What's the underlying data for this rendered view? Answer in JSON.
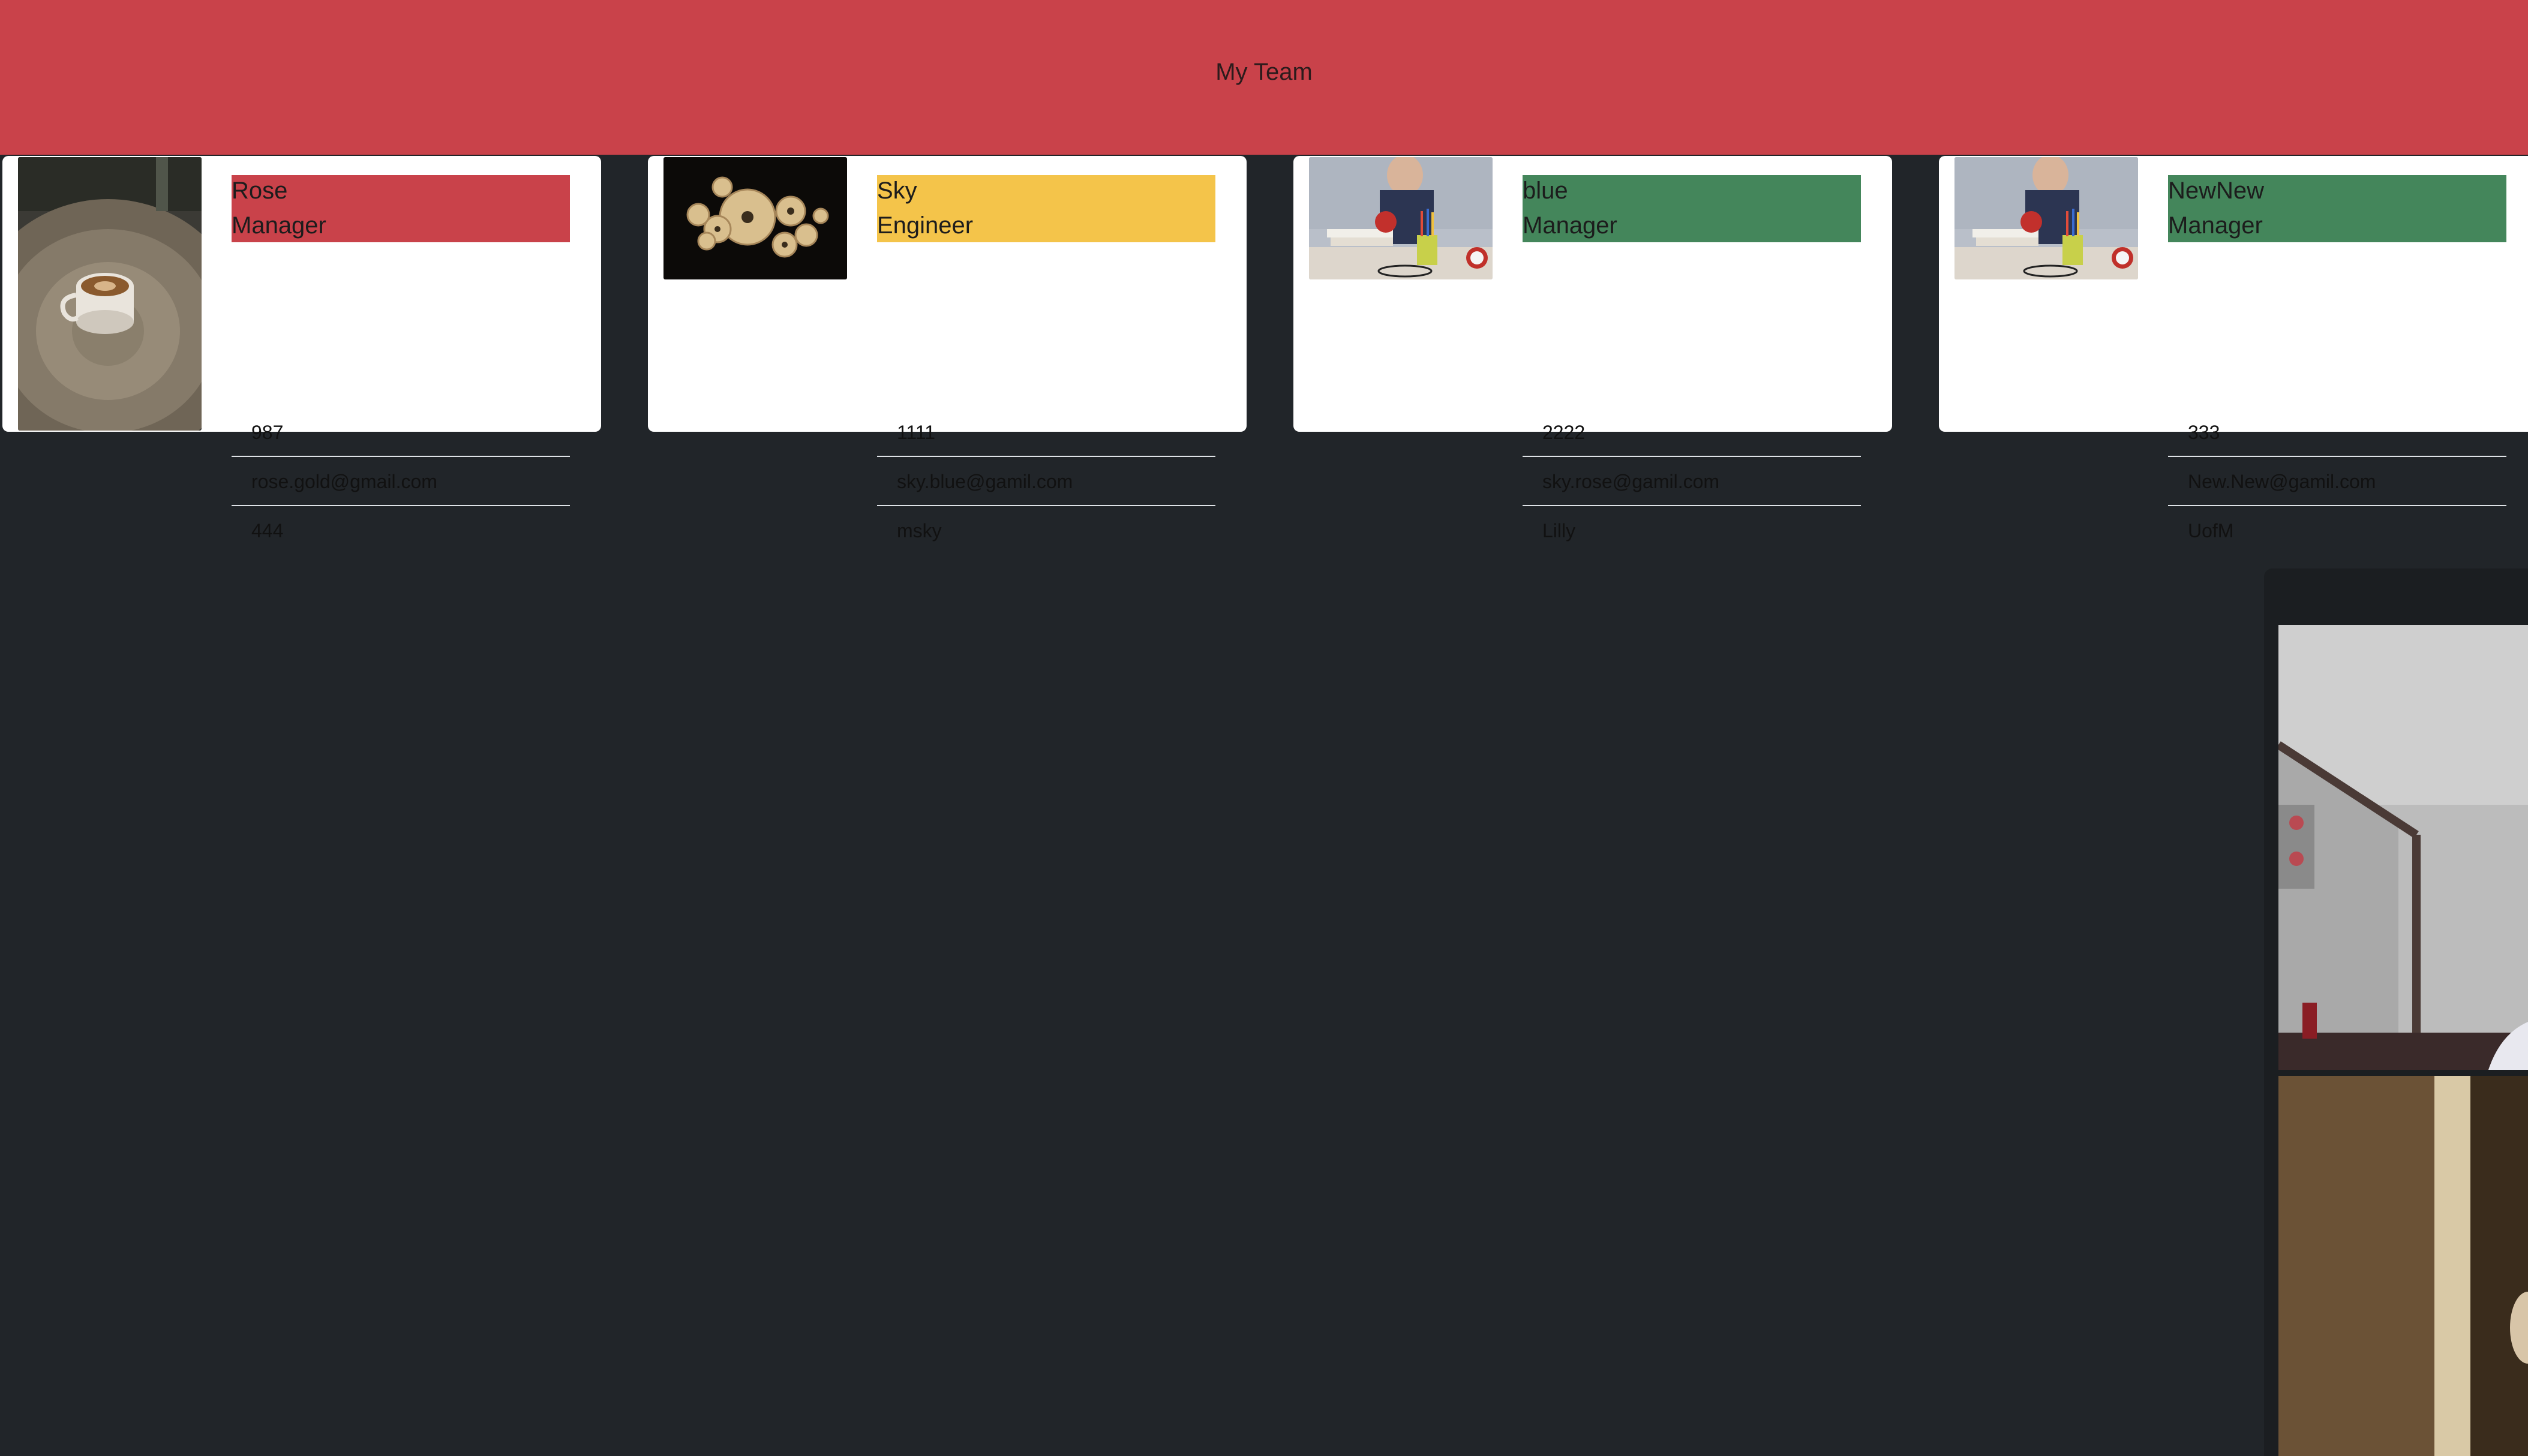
{
  "header": {
    "title": "My Team"
  },
  "colors": {
    "header_bg": "#c9424a",
    "page_bg": "#212529",
    "manager": "#c9424a",
    "engineer": "#f4c44a",
    "intern": "#44865b"
  },
  "members": [
    {
      "name": "Rose",
      "role": "Manager",
      "id": "987",
      "email": "rose.gold@gmail.com",
      "extra": "444",
      "role_color": "#c9424a",
      "photo_icon": "coffee-cup-photo"
    },
    {
      "name": "Sky",
      "role": "Engineer",
      "id": "1111",
      "email": "sky.blue@gamil.com",
      "extra": "msky",
      "role_color": "#f4c44a",
      "photo_icon": "gears-photo"
    },
    {
      "name": "blue",
      "role": "Manager",
      "id": "2222",
      "email": "sky.rose@gamil.com",
      "extra": "Lilly",
      "role_color": "#44865b",
      "photo_icon": "student-desk-photo"
    },
    {
      "name": "NewNew",
      "role": "Manager",
      "id": "333",
      "email": "New.New@gamil.com",
      "extra": "UofM",
      "role_color": "#44865b",
      "photo_icon": "student-desk-photo"
    }
  ]
}
